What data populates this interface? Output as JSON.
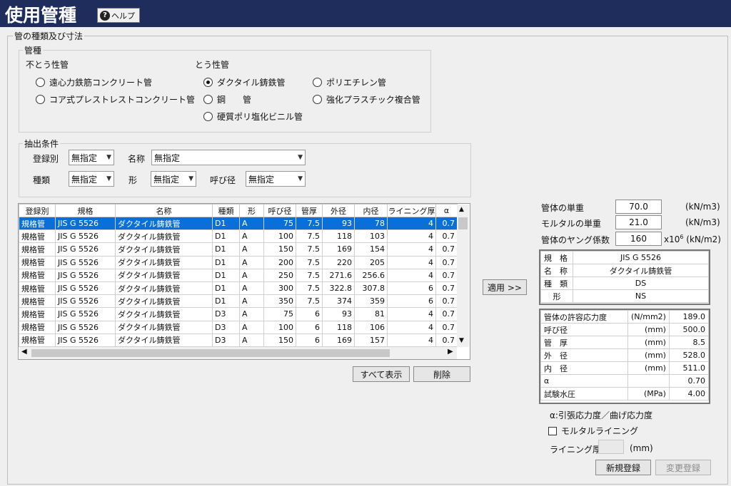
{
  "title": "使用管種",
  "help_label": "ヘルプ",
  "section_title": "管の種類及び寸法",
  "pipe_type": {
    "legend": "管種",
    "nonpressure_label": "不とう性管",
    "pressure_label": "とう性管",
    "options": [
      {
        "label": "遠心力鉄筋コンクリート管",
        "selected": false
      },
      {
        "label": "コア式プレストレストコンクリート管",
        "selected": false
      },
      {
        "label": "ダクタイル鋳鉄管",
        "selected": true
      },
      {
        "label": "鋼　　管",
        "selected": false
      },
      {
        "label": "硬質ポリ塩化ビニル管",
        "selected": false
      },
      {
        "label": "ポリエチレン管",
        "selected": false
      },
      {
        "label": "強化プラスチック複合管",
        "selected": false
      }
    ]
  },
  "filter": {
    "legend": "抽出条件",
    "registry_label": "登録別",
    "registry_value": "無指定",
    "name_label": "名称",
    "name_value": "無指定",
    "kind_label": "種類",
    "kind_value": "無指定",
    "shape_label": "形",
    "shape_value": "無指定",
    "nominal_label": "呼び径",
    "nominal_value": "無指定"
  },
  "grid": {
    "columns": [
      "登録別",
      "規格",
      "名称",
      "種類",
      "形",
      "呼び径",
      "管厚",
      "外径",
      "内径",
      "ライニング厚",
      "α"
    ],
    "rows": [
      [
        "規格管",
        "JIS G 5526",
        "ダクタイル鋳鉄管",
        "D1",
        "A",
        "75",
        "7.5",
        "93",
        "78",
        "4",
        "0.7"
      ],
      [
        "規格管",
        "JIS G 5526",
        "ダクタイル鋳鉄管",
        "D1",
        "A",
        "100",
        "7.5",
        "118",
        "103",
        "4",
        "0.7"
      ],
      [
        "規格管",
        "JIS G 5526",
        "ダクタイル鋳鉄管",
        "D1",
        "A",
        "150",
        "7.5",
        "169",
        "154",
        "4",
        "0.7"
      ],
      [
        "規格管",
        "JIS G 5526",
        "ダクタイル鋳鉄管",
        "D1",
        "A",
        "200",
        "7.5",
        "220",
        "205",
        "4",
        "0.7"
      ],
      [
        "規格管",
        "JIS G 5526",
        "ダクタイル鋳鉄管",
        "D1",
        "A",
        "250",
        "7.5",
        "271.6",
        "256.6",
        "4",
        "0.7"
      ],
      [
        "規格管",
        "JIS G 5526",
        "ダクタイル鋳鉄管",
        "D1",
        "A",
        "300",
        "7.5",
        "322.8",
        "307.8",
        "6",
        "0.7"
      ],
      [
        "規格管",
        "JIS G 5526",
        "ダクタイル鋳鉄管",
        "D1",
        "A",
        "350",
        "7.5",
        "374",
        "359",
        "6",
        "0.7"
      ],
      [
        "規格管",
        "JIS G 5526",
        "ダクタイル鋳鉄管",
        "D3",
        "A",
        "75",
        "6",
        "93",
        "81",
        "4",
        "0.7"
      ],
      [
        "規格管",
        "JIS G 5526",
        "ダクタイル鋳鉄管",
        "D3",
        "A",
        "100",
        "6",
        "118",
        "106",
        "4",
        "0.7"
      ],
      [
        "規格管",
        "JIS G 5526",
        "ダクタイル鋳鉄管",
        "D3",
        "A",
        "150",
        "6",
        "169",
        "157",
        "4",
        "0.7"
      ]
    ],
    "selected_row": 0
  },
  "buttons": {
    "show_all": "すべて表示",
    "delete": "削除",
    "apply": "適用 >>",
    "new_register": "新規登録",
    "change_register": "変更登録"
  },
  "weights": {
    "pipe_weight_label": "管体の単重",
    "pipe_weight_value": "70.0",
    "pipe_weight_unit": "(kN/m3)",
    "mortar_weight_label": "モルタルの単重",
    "mortar_weight_value": "21.0",
    "mortar_weight_unit": "(kN/m3)",
    "young_label": "管体のヤング係数",
    "young_value": "160",
    "young_unit_prefix": "x10",
    "young_unit_exp": "6",
    "young_unit_suffix": "(kN/m2)"
  },
  "spec": [
    {
      "label": "規　格",
      "value": "JIS G 5526"
    },
    {
      "label": "名　称",
      "value": "ダクタイル鋳鉄管"
    },
    {
      "label": "種　類",
      "value": "DS"
    },
    {
      "label": "形",
      "value": "NS"
    }
  ],
  "props": [
    {
      "label": "管体の許容応力度",
      "unit": "(N/mm2)",
      "value": "189.0"
    },
    {
      "label": "呼び径",
      "unit": "(mm)",
      "value": "500.0"
    },
    {
      "label": "管　厚",
      "unit": "(mm)",
      "value": "8.5"
    },
    {
      "label": "外　径",
      "unit": "(mm)",
      "value": "528.0"
    },
    {
      "label": "内　径",
      "unit": "(mm)",
      "value": "511.0"
    },
    {
      "label": "α",
      "unit": "",
      "value": "0.70"
    },
    {
      "label": "試験水圧",
      "unit": "(MPa)",
      "value": "4.00"
    }
  ],
  "alpha_note": "α:引張応力度／曲げ応力度",
  "mortar_lining_label": "モルタルライニング",
  "lining_thickness_label": "ライニング厚",
  "lining_thickness_value": "",
  "lining_thickness_unit": "(mm)"
}
